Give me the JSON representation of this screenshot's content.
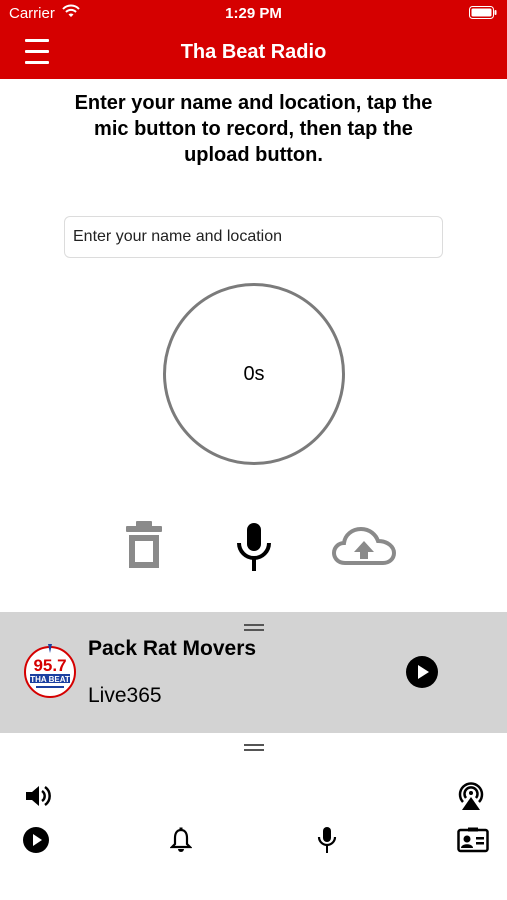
{
  "status_bar": {
    "carrier": "Carrier",
    "time": "1:29 PM"
  },
  "header": {
    "title": "Tha Beat Radio",
    "menu_icon": "hamburger-icon"
  },
  "recorder": {
    "instructions": "Enter your name and location, tap the mic button to record, then tap the upload button.",
    "name_input": {
      "placeholder": "Enter your name and location",
      "value": ""
    },
    "timer": "0s",
    "controls": {
      "delete_icon": "trash-icon",
      "record_icon": "microphone-icon",
      "upload_icon": "cloud-upload-icon"
    }
  },
  "now_playing": {
    "logo_text": "95.7 THA BEAT",
    "title": "Pack Rat Movers",
    "subtitle": "Live365",
    "play_icon": "play-circle-icon"
  },
  "bottom_bar": {
    "icons": [
      "speaker-volume-icon",
      "airplay-icon",
      "play-circle-icon",
      "bell-icon",
      "microphone-icon",
      "contact-card-icon"
    ]
  },
  "colors": {
    "brand_red": "#d50000",
    "player_bg": "#d3d3d3",
    "control_gray": "#8a8a8a",
    "logo_blue": "#1a3fa0"
  }
}
